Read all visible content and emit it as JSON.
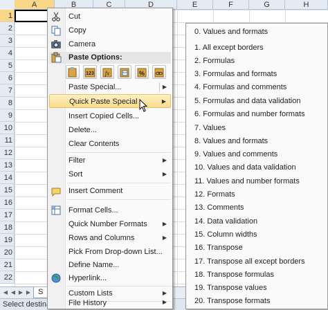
{
  "spreadsheet": {
    "columns": [
      "A",
      "B",
      "C",
      "D",
      "E",
      "F",
      "G",
      "H"
    ],
    "rows": [
      "1",
      "2",
      "3",
      "4",
      "5",
      "6",
      "7",
      "8",
      "9",
      "10",
      "11",
      "12",
      "13",
      "14",
      "15",
      "16",
      "17",
      "18",
      "19",
      "20",
      "21",
      "22"
    ],
    "sheet_tab_label": "S",
    "status_text": "Select destina"
  },
  "context_menu": {
    "cut": "Cut",
    "copy": "Copy",
    "camera": "Camera",
    "paste_options_header": "Paste Options:",
    "paste_option_icons": [
      "paste-icon",
      "paste-values-icon",
      "paste-formulas-icon",
      "paste-transpose-icon",
      "paste-formatting-icon",
      "paste-link-icon"
    ],
    "paste_special": "Paste Special...",
    "quick_paste_special": "Quick Paste Special",
    "insert_copied_cells": "Insert Copied Cells...",
    "delete": "Delete...",
    "clear_contents": "Clear Contents",
    "filter": "Filter",
    "sort": "Sort",
    "insert_comment": "Insert Comment",
    "format_cells": "Format Cells...",
    "quick_number_formats": "Quick Number Formats",
    "rows_and_columns": "Rows and Columns",
    "pick_from_dropdown": "Pick From Drop-down List...",
    "define_name": "Define Name...",
    "hyperlink": "Hyperlink...",
    "custom_lists": "Custom Lists",
    "file_history": "File History"
  },
  "submenu": {
    "items": [
      "0. Values and formats",
      "1. All except borders",
      "2. Formulas",
      "3. Formulas and formats",
      "4. Formulas and comments",
      "5. Formulas and data validation",
      "6. Formulas and number formats",
      "7. Values",
      "8. Values and formats",
      "9. Values and comments",
      "10. Values and data validation",
      "11. Values and number formats",
      "12. Formats",
      "13. Comments",
      "14. Data validation",
      "15. Column widths",
      "16. Transpose",
      "17. Transpose all except borders",
      "18. Transpose formulas",
      "19. Transpose values",
      "20. Transpose formats"
    ]
  },
  "colors": {
    "highlight": "#fbdc8c",
    "header_selected": "#f8d789",
    "grid": "#dadcdd"
  }
}
